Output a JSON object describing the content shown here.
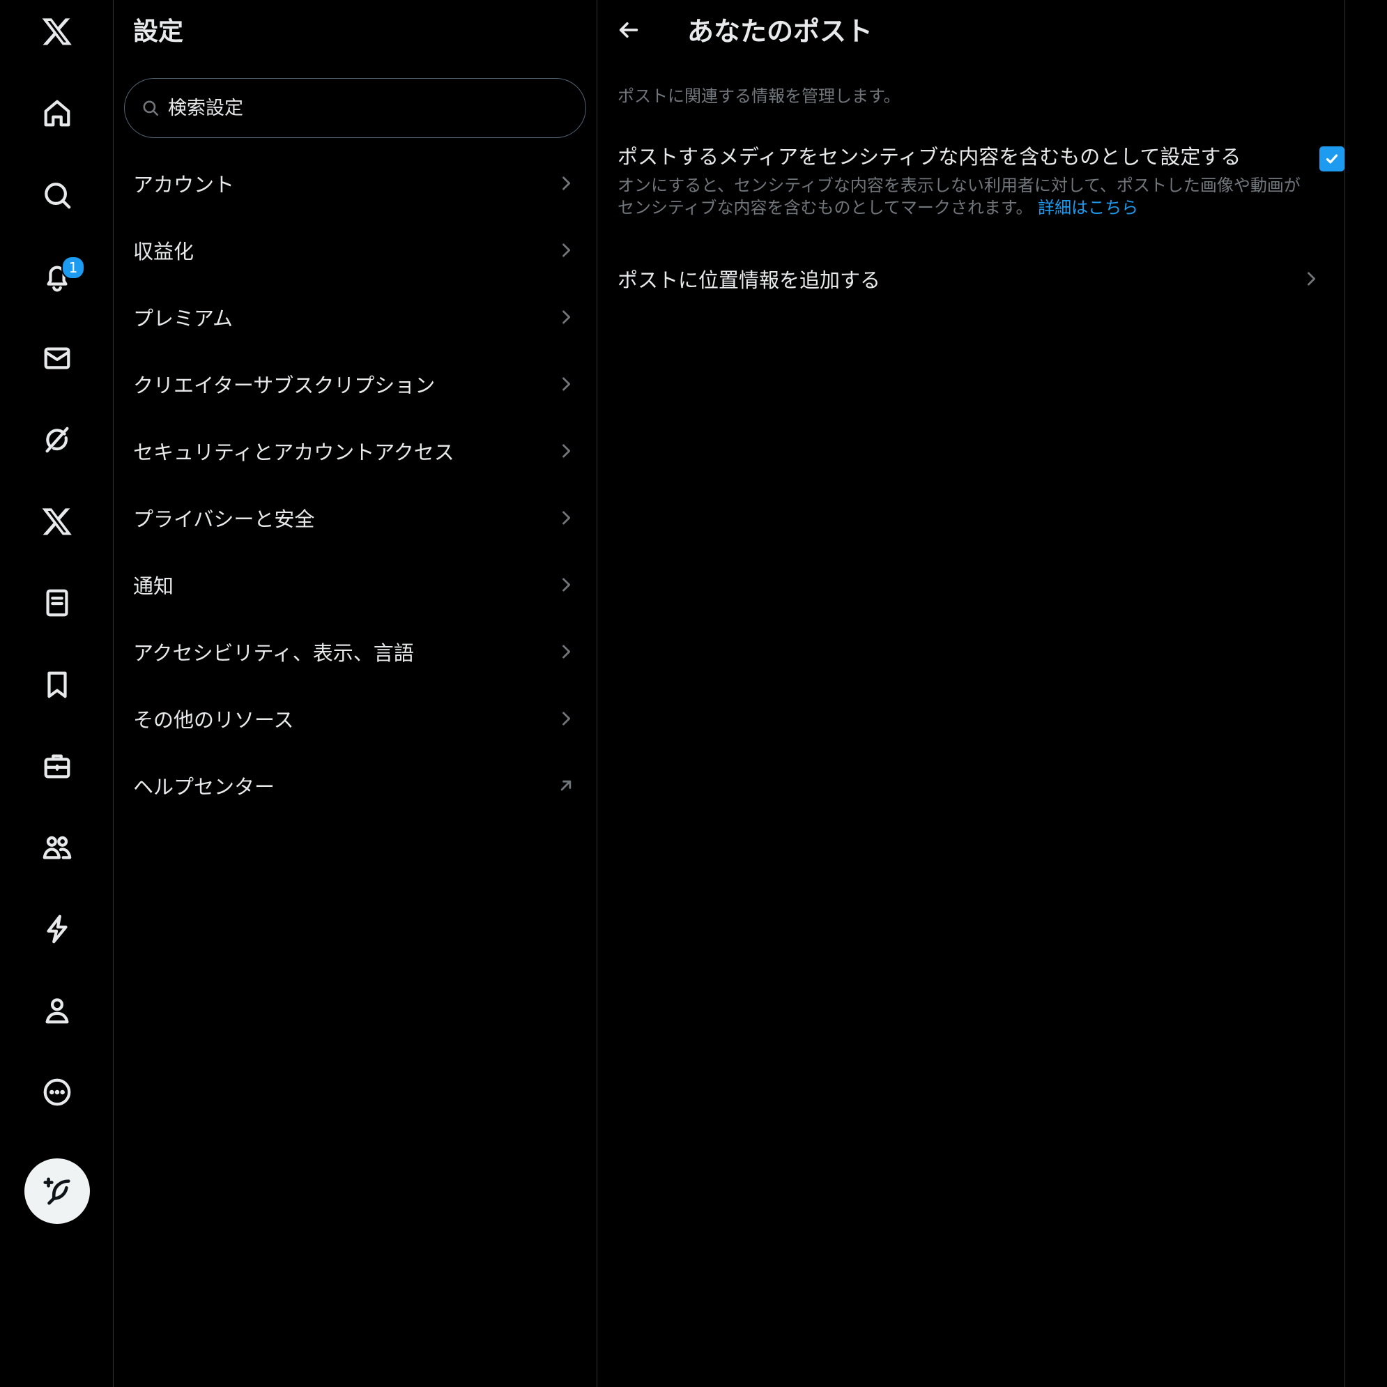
{
  "nav": {
    "items": [
      {
        "name": "x-logo-icon"
      },
      {
        "name": "home-icon"
      },
      {
        "name": "explore-icon"
      },
      {
        "name": "notifications-icon"
      },
      {
        "name": "messages-icon"
      },
      {
        "name": "grok-icon"
      },
      {
        "name": "premium-icon"
      },
      {
        "name": "lists-icon"
      },
      {
        "name": "bookmarks-icon"
      },
      {
        "name": "jobs-icon"
      },
      {
        "name": "communities-icon"
      },
      {
        "name": "verified-orgs-icon"
      },
      {
        "name": "profile-icon"
      },
      {
        "name": "more-icon"
      }
    ],
    "notification_badge": "1",
    "compose_icon": "compose-post-icon"
  },
  "settings": {
    "title": "設定",
    "search_placeholder": "検索設定",
    "items": [
      {
        "label": "アカウント",
        "icon": "chevron-right-icon"
      },
      {
        "label": "収益化",
        "icon": "chevron-right-icon"
      },
      {
        "label": "プレミアム",
        "icon": "chevron-right-icon"
      },
      {
        "label": "クリエイターサブスクリプション",
        "icon": "chevron-right-icon"
      },
      {
        "label": "セキュリティとアカウントアクセス",
        "icon": "chevron-right-icon"
      },
      {
        "label": "プライバシーと安全",
        "icon": "chevron-right-icon"
      },
      {
        "label": "通知",
        "icon": "chevron-right-icon"
      },
      {
        "label": "アクセシビリティ、表示、言語",
        "icon": "chevron-right-icon"
      },
      {
        "label": "その他のリソース",
        "icon": "chevron-right-icon"
      },
      {
        "label": "ヘルプセンター",
        "icon": "external-link-icon"
      }
    ]
  },
  "detail": {
    "title": "あなたのポスト",
    "description": "ポストに関連する情報を管理します。",
    "sensitive_media": {
      "label": "ポストするメディアをセンシティブな内容を含むものとして設定する",
      "help": "オンにすると、センシティブな内容を表示しない利用者に対して、ポストした画像や動画がセンシティブな内容を含むものとしてマークされます。",
      "link": "詳細はこちら",
      "checked": true
    },
    "location": {
      "label": "ポストに位置情報を追加する"
    }
  },
  "colors": {
    "background": "#000000",
    "text": "#e7e9ea",
    "secondary_text": "#71767b",
    "accent": "#1d9bf0",
    "border": "#2f3336"
  }
}
